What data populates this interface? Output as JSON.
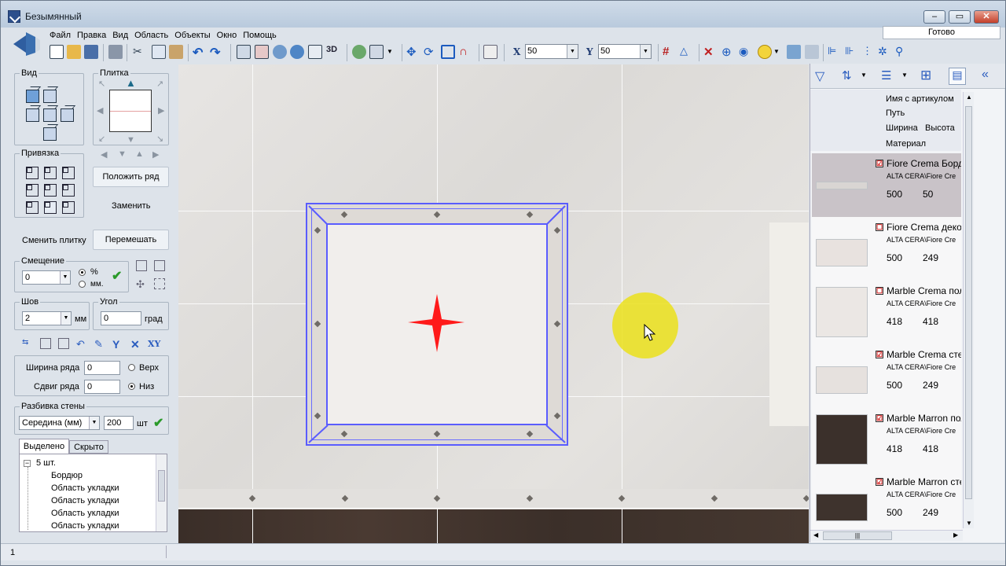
{
  "window": {
    "title": "Безымянный",
    "min": "–",
    "max": "▭",
    "close": "✕"
  },
  "menu": [
    "Файл",
    "Правка",
    "Вид",
    "Область",
    "Объекты",
    "Окно",
    "Помощь"
  ],
  "status_ready": "Готово",
  "toolbar": {
    "x_label": "X",
    "x_value": "50",
    "y_label": "Y",
    "y_value": "50",
    "three_d": "3D"
  },
  "left": {
    "vid": "Вид",
    "plitka": "Плитка",
    "privyazka": "Привязка",
    "polozhit_ryad": "Положить ряд",
    "zamenit": "Заменить",
    "smenit_plitku": "Сменить плитку",
    "peremeshat": "Перемешать",
    "smeshenie": "Смещение",
    "smeshenie_value": "0",
    "pct": "%",
    "mm_dot": "мм.",
    "shov": "Шов",
    "shov_value": "2",
    "mm": "мм",
    "ugol": "Угол",
    "ugol_value": "0",
    "grad": "град",
    "xy": "XY",
    "shirina_ryada": "Ширина ряда",
    "shirina_value": "0",
    "verh": "Верх",
    "sdvig_ryada": "Сдвиг ряда",
    "sdvig_value": "0",
    "niz": "Низ",
    "razbivka": "Разбивка стены",
    "razbivka_mode": "Середина (мм)",
    "razbivka_value": "200",
    "sht": "шт",
    "tab_selected": "Выделено",
    "tab_hidden": "Скрыто",
    "tree_root": "5 шт.",
    "tree_items": [
      "Бордюр",
      "Область укладки",
      "Область укладки",
      "Область укладки",
      "Область укладки"
    ]
  },
  "right": {
    "headers": {
      "name": "Имя с артикулом",
      "path": "Путь",
      "width": "Ширина",
      "height": "Высота",
      "material": "Материал"
    },
    "items": [
      {
        "name": "Fiore Crema Борд",
        "path": "ALTA CERA\\Fiore Cre",
        "w": "500",
        "h": "50",
        "checked": "☑",
        "color": "#d9d5d3"
      },
      {
        "name": "Fiore Crema деко",
        "path": "ALTA CERA\\Fiore Cre",
        "w": "500",
        "h": "249",
        "checked": "☐",
        "color": "#e8e2df"
      },
      {
        "name": "Marble Crema пол",
        "path": "ALTA CERA\\Fiore Cre",
        "w": "418",
        "h": "418",
        "checked": "☐",
        "color": "#ebe7e4"
      },
      {
        "name": "Marble Crema сте",
        "path": "ALTA CERA\\Fiore Cre",
        "w": "500",
        "h": "249",
        "checked": "☑",
        "color": "#e6e1de"
      },
      {
        "name": "Marble Marron пол",
        "path": "ALTA CERA\\Fiore Cre",
        "w": "418",
        "h": "418",
        "checked": "☑",
        "color": "#3b302b"
      },
      {
        "name": "Marble Marron сте",
        "path": "ALTA CERA\\Fiore Cre",
        "w": "500",
        "h": "249",
        "checked": "☑",
        "color": "#3e332d"
      }
    ],
    "hscroll_mid": "|||"
  },
  "status_num": "1"
}
